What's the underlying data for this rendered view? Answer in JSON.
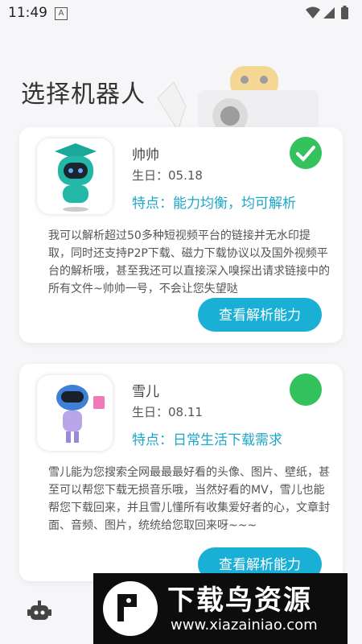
{
  "status": {
    "time": "11:49",
    "notif_glyph": "A"
  },
  "page": {
    "title": "选择机器人"
  },
  "robots": [
    {
      "name": "帅帅",
      "birthday": "生日：05.18",
      "feature": "特点：能力均衡，均可解析",
      "description": "我可以解析超过50多种短视频平台的链接并无水印提取，同时还支持P2P下载、磁力下载协议以及国外视频平台的解析哦，甚至我还可以直接深入嗅探出请求链接中的所有文件~帅帅一号，不会让您失望哒",
      "button_label": "查看解析能力",
      "selected": true
    },
    {
      "name": "雪儿",
      "birthday": "生日：08.11",
      "feature": "特点：日常生活下载需求",
      "description": "雪儿能为您搜索全网最最最好看的头像、图片、壁纸，甚至可以帮您下载无损音乐哦，当然好看的MV，雪儿也能帮您下载回来，并且雪儿懂所有收集爱好者的心，文章封面、音频、图片，统统给您取回来呀~~~",
      "button_label": "查看解析能力",
      "selected": false
    }
  ],
  "watermark": {
    "title": "下载鸟资源",
    "url": "www.xiazainiao.com"
  },
  "colors": {
    "accent": "#1ab0d6",
    "feature_text": "#1ca7c9",
    "selected": "#34c25d"
  }
}
